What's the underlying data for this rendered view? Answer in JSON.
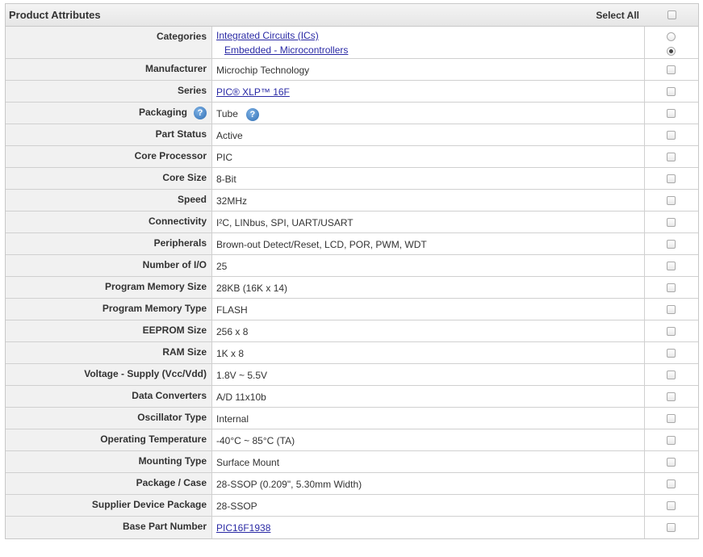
{
  "header": {
    "title": "Product Attributes",
    "select_all": "Select All"
  },
  "categories": {
    "label": "Categories",
    "items": [
      "Integrated Circuits (ICs)",
      "Embedded - Microcontrollers"
    ]
  },
  "rows": [
    {
      "label": "Manufacturer",
      "value": "Microchip Technology"
    },
    {
      "label": "Series",
      "value": "PIC® XLP™ 16F",
      "link": true
    },
    {
      "label": "Packaging",
      "value": "Tube",
      "help": true
    },
    {
      "label": "Part Status",
      "value": "Active"
    },
    {
      "label": "Core Processor",
      "value": "PIC"
    },
    {
      "label": "Core Size",
      "value": "8-Bit"
    },
    {
      "label": "Speed",
      "value": "32MHz"
    },
    {
      "label": "Connectivity",
      "value": "I²C, LINbus, SPI, UART/USART"
    },
    {
      "label": "Peripherals",
      "value": "Brown-out Detect/Reset, LCD, POR, PWM, WDT"
    },
    {
      "label": "Number of I/O",
      "value": "25"
    },
    {
      "label": "Program Memory Size",
      "value": "28KB (16K x 14)"
    },
    {
      "label": "Program Memory Type",
      "value": "FLASH"
    },
    {
      "label": "EEPROM Size",
      "value": "256 x 8"
    },
    {
      "label": "RAM Size",
      "value": "1K x 8"
    },
    {
      "label": "Voltage - Supply (Vcc/Vdd)",
      "value": "1.8V ~ 5.5V"
    },
    {
      "label": "Data Converters",
      "value": "A/D 11x10b"
    },
    {
      "label": "Oscillator Type",
      "value": "Internal"
    },
    {
      "label": "Operating Temperature",
      "value": "-40°C ~ 85°C (TA)"
    },
    {
      "label": "Mounting Type",
      "value": "Surface Mount"
    },
    {
      "label": "Package / Case",
      "value": "28-SSOP (0.209\", 5.30mm Width)"
    },
    {
      "label": "Supplier Device Package",
      "value": "28-SSOP"
    },
    {
      "label": "Base Part Number",
      "value": "PIC16F1938",
      "link": true
    }
  ],
  "help_glyph": "?"
}
